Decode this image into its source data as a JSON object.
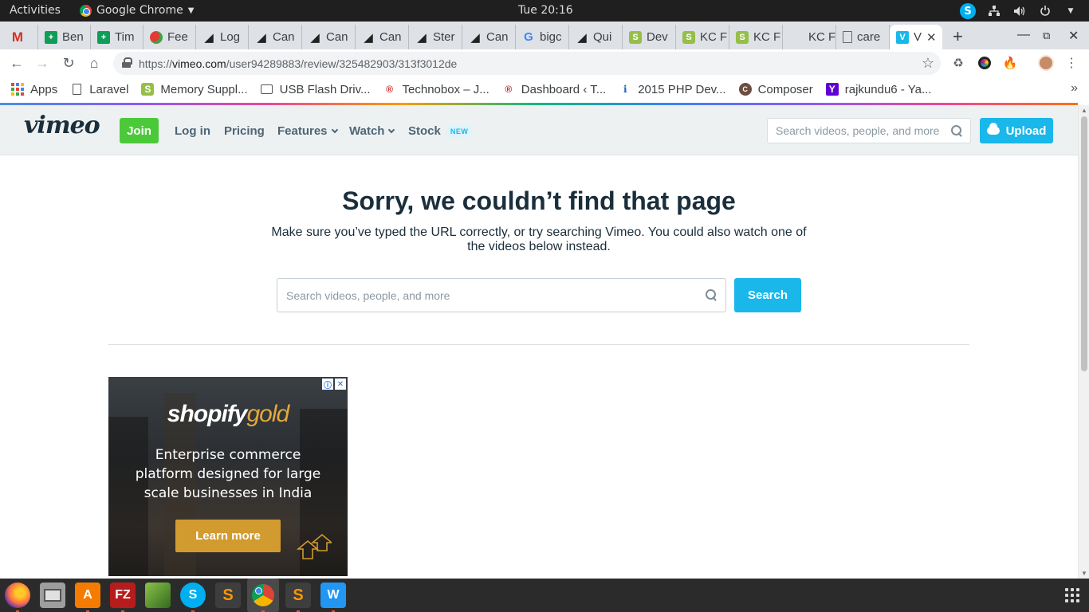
{
  "os_topbar": {
    "activities": "Activities",
    "app_name": "Google Chrome",
    "clock": "Tue 20:16"
  },
  "tabs": [
    {
      "label": "",
      "icon": "gmail-icon"
    },
    {
      "label": "Ben",
      "icon": "sheets-icon"
    },
    {
      "label": "Tim",
      "icon": "sheets-icon"
    },
    {
      "label": "Fee",
      "icon": "feed-icon"
    },
    {
      "label": "Log",
      "icon": "bigcommerce-icon"
    },
    {
      "label": "Can",
      "icon": "bigcommerce-icon"
    },
    {
      "label": "Can",
      "icon": "bigcommerce-icon"
    },
    {
      "label": "Can",
      "icon": "bigcommerce-icon"
    },
    {
      "label": "Ster",
      "icon": "bigcommerce-icon"
    },
    {
      "label": "Can",
      "icon": "bigcommerce-icon"
    },
    {
      "label": "bigc",
      "icon": "google-icon"
    },
    {
      "label": "Qui",
      "icon": "bigcommerce-icon"
    },
    {
      "label": "Dev",
      "icon": "shopify-icon"
    },
    {
      "label": "KC F",
      "icon": "shopify-icon"
    },
    {
      "label": "KC F",
      "icon": "shopify-icon"
    },
    {
      "label": "KC F",
      "icon": "blank-icon"
    },
    {
      "label": "care",
      "icon": "document-icon"
    },
    {
      "label": "V",
      "icon": "vimeo-icon",
      "active": true
    }
  ],
  "address_bar": {
    "scheme": "https://",
    "host": "vimeo.com",
    "path": "/user94289883/review/325482903/313f3012de"
  },
  "bookmarks": [
    {
      "label": "Apps",
      "icon": "apps-grid-icon"
    },
    {
      "label": "Laravel",
      "icon": "page-icon"
    },
    {
      "label": "Memory Suppl...",
      "icon": "shopify-icon"
    },
    {
      "label": "USB Flash Driv...",
      "icon": "briefcase-icon"
    },
    {
      "label": "Technobox – J...",
      "icon": "technobox-icon"
    },
    {
      "label": "Dashboard ‹ T...",
      "icon": "technobox-icon"
    },
    {
      "label": "2015 PHP Dev...",
      "icon": "info-icon"
    },
    {
      "label": "Composer",
      "icon": "composer-icon"
    },
    {
      "label": "rajkundu6 - Ya...",
      "icon": "yahoo-icon"
    }
  ],
  "vimeo_header": {
    "logo": "vimeo",
    "join": "Join",
    "login": "Log in",
    "pricing": "Pricing",
    "features": "Features",
    "watch": "Watch",
    "stock": "Stock",
    "stock_badge": "NEW",
    "search_placeholder": "Search videos, people, and more",
    "upload": "Upload"
  },
  "error": {
    "title": "Sorry, we couldn’t find that page",
    "subtitle": "Make sure you’ve typed the URL correctly, or try searching Vimeo. You could also watch one of the videos below instead.",
    "search_placeholder": "Search videos, people, and more",
    "search_button": "Search"
  },
  "ad": {
    "brand_main": "shopify",
    "brand_accent": "gold",
    "copy": "Enterprise commerce platform designed for large scale businesses in India",
    "cta": "Learn more",
    "accent_color": "#d19b2f"
  },
  "dock": [
    "firefox-icon",
    "files-icon",
    "software-center-icon",
    "filezilla-icon",
    "image-viewer-icon",
    "skype-icon",
    "sublime-text-icon",
    "chrome-icon",
    "sublime-text-icon",
    "wps-writer-icon"
  ]
}
